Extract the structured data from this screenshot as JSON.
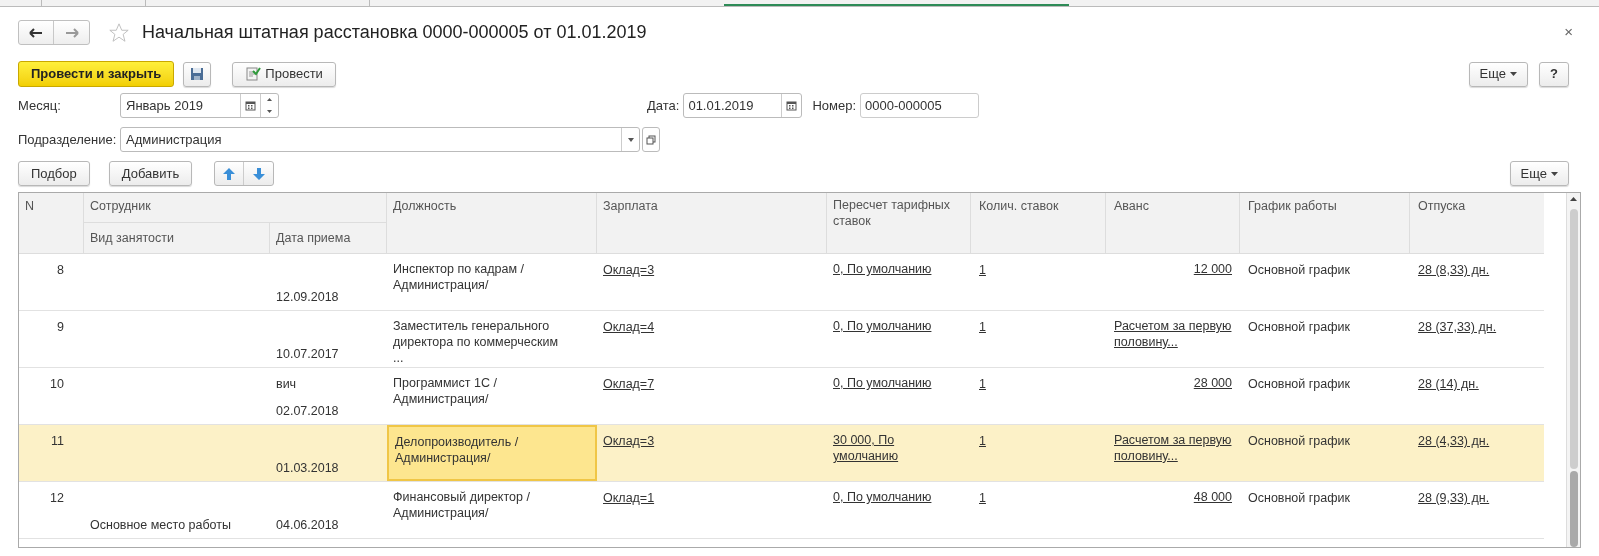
{
  "window": {
    "title": "Начальная штатная расстановка 0000-000005 от 01.01.2019",
    "favorite": false,
    "close": "×"
  },
  "toolbar": {
    "post_close": "Провести и закрыть",
    "post": "Провести",
    "more": "Еще",
    "help": "?"
  },
  "fields": {
    "month_label": "Месяц:",
    "month": "Январь 2019",
    "date_label": "Дата:",
    "date": "01.01.2019",
    "number_label": "Номер:",
    "number": "0000-000005",
    "department_label": "Подразделение:",
    "department": "Администрация"
  },
  "table_toolbar": {
    "pick": "Подбор",
    "add": "Добавить",
    "more": "Еще"
  },
  "table": {
    "columns": {
      "n": "N",
      "employee": "Сотрудник",
      "employment": "Вид занятости",
      "hire_date": "Дата приема",
      "position": "Должность",
      "salary": "Зарплата",
      "recalc": "Пересчет тарифных ставок",
      "rates": "Колич. ставок",
      "advance": "Аванс",
      "schedule": "График работы",
      "vacation": "Отпуска"
    },
    "rows": [
      {
        "n": "8",
        "hire_date": "12.09.2018",
        "position": "Инспектор по кадрам /Администрация/",
        "salary": "Оклад=3",
        "recalc": "0, По умолчанию",
        "rates": "1",
        "advance": "12 000",
        "kind": "amount",
        "schedule": "Основной график",
        "vacation": "28 (8,33) дн.",
        "selected": false
      },
      {
        "n": "9",
        "hire_date": "10.07.2017",
        "position": "Заместитель генерального директора по коммерческим ...",
        "salary": "Оклад=4",
        "recalc": "0, По умолчанию",
        "rates": "1",
        "advance": "Расчетом за первую половину...",
        "kind": "text",
        "schedule": "Основной график",
        "vacation": "28 (37,33) дн.",
        "selected": false
      },
      {
        "n": "10",
        "employee": "вич",
        "hire_date": "02.07.2018",
        "position": "Программист 1С /Администрация/",
        "salary": "Оклад=7",
        "recalc": "0, По умолчанию",
        "rates": "1",
        "advance": "28 000",
        "kind": "amount",
        "schedule": "Основной график",
        "vacation": "28 (14) дн.",
        "selected": false
      },
      {
        "n": "11",
        "hire_date": "01.03.2018",
        "position": "Делопроизводитель /Администрация/",
        "salary": "Оклад=3",
        "recalc": "30 000, По умолчанию",
        "rates": "1",
        "advance": "Расчетом за первую половину...",
        "kind": "text",
        "schedule": "Основной график",
        "vacation": "28 (4,33) дн.",
        "selected": true
      },
      {
        "n": "12",
        "employment": "Основное место работы",
        "hire_date": "04.06.2018",
        "position": "Финансовый директор /Администрация/",
        "salary": "Оклад=1",
        "recalc": "0, По умолчанию",
        "rates": "1",
        "advance": "48 000",
        "kind": "amount",
        "schedule": "Основной график",
        "vacation": "28 (9,33) дн.",
        "selected": false
      }
    ]
  }
}
